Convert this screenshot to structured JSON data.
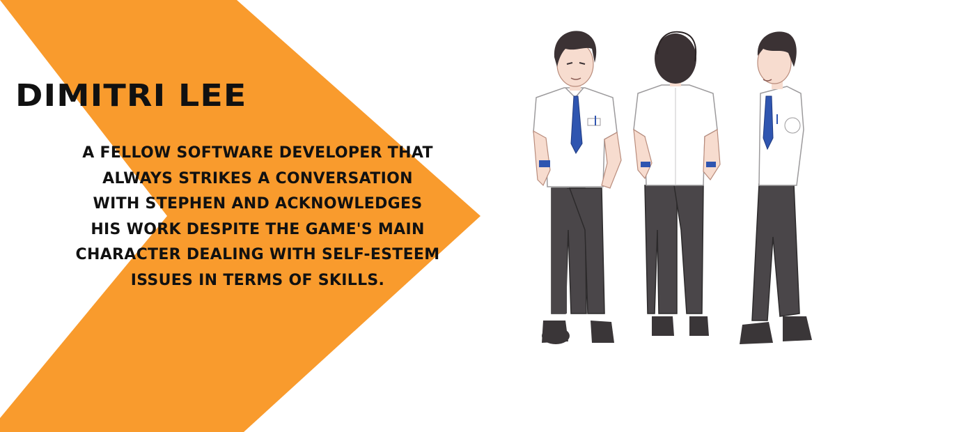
{
  "character": {
    "name": "DIMITRI LEE",
    "description_lines": [
      "A FELLOW SOFTWARE DEVELOPER THAT",
      "ALWAYS STRIKES A CONVERSATION",
      "WITH STEPHEN AND ACKNOWLEDGES",
      "HIS WORK DESPITE THE GAME'S MAIN",
      "CHARACTER DEALING WITH SELF-ESTEEM",
      "ISSUES IN TERMS OF SKILLS."
    ],
    "turnaround_views": [
      "front",
      "back",
      "side"
    ]
  },
  "colors": {
    "background": "#ffffff",
    "accent_orange": "#f99b2d",
    "text": "#111111",
    "shirt": "#ffffff",
    "tie": "#2f55b0",
    "pants": "#4a4649",
    "shoes": "#3a3638",
    "hair": "#3b3234",
    "skin": "#f7dccf"
  }
}
